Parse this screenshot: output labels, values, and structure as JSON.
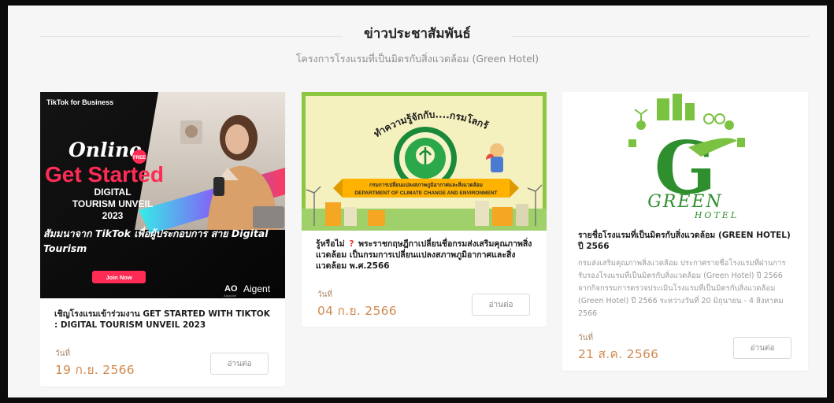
{
  "section": {
    "title": "ข่าวประชาสัมพันธ์",
    "subtitle": "โครงการโรงแรมที่เป็นมิตรกับสิ่งแวดล้อม (Green Hotel)"
  },
  "colors": {
    "accent_date": "#d08a4f",
    "tiktok_pink": "#ff2d55",
    "green_logo": "#2f8f2f"
  },
  "cards": [
    {
      "banner": {
        "brand": "TikTok for Business",
        "headline_script": "Online",
        "headline_tag": "FREE",
        "headline_big": "Get Started",
        "event_line1": "DIGITAL",
        "event_line2": "TOURISM UNVEIL",
        "event_line3": "2023",
        "thai_tagline": "สัมมนาจาก TikTok เพื่อผู้ประกอบการ สาย Digital Tourism",
        "cta": "Join Now",
        "partner_mark": "AO",
        "partner_name": "Aigent",
        "partner_sub": "AAppoint"
      },
      "title": "เชิญโรงแรมเข้าร่วมงาน GET STARTED WITH TIKTOK : DIGITAL TOURISM UNVEIL 2023",
      "date_label": "วันที่",
      "date": "19 ก.ย. 2566",
      "button": "อ่านต่อ"
    },
    {
      "banner": {
        "arc_text": "ทำความรู้จักกับ....กรมโลกร้อน ?",
        "ribbon_th": "กรมการเปลี่ยนแปลงสภาพภูมิอากาศและสิ่งแวดล้อม",
        "ribbon_en": "DEPARTMENT OF CLIMATE CHANGE AND ENVIRONMENT",
        "seal_text": "DEPARTMENT OF CLIMATE CHANGE AND ENVIRONMENT"
      },
      "title_prefix": "รู้หรือไม่",
      "title_mark": "?",
      "title": "พระราชกฤษฎีกาเปลี่ยนชื่อกรมส่งเสริมคุณภาพสิ่งแวดล้อม เป็นกรมการเปลี่ยนแปลงสภาพภูมิอากาศและสิ่งแวดล้อม พ.ศ.2566",
      "date_label": "วันที่",
      "date": "04 ก.ย. 2566",
      "button": "อ่านต่อ"
    },
    {
      "banner": {
        "logo_letter": "G",
        "logo_word": "GREEN",
        "logo_sub": "HOTEL"
      },
      "title": "รายชื่อโรงแรมที่เป็นมิตรกับสิ่งแวดล้อม (GREEN HOTEL) ปี 2566",
      "description": "กรมส่งเสริมคุณภาพสิ่งแวดล้อม ประกาศรายชื่อโรงแรมที่ผ่านการรับรองโรงแรมที่เป็นมิตรกับสิ่งแวดล้อม (Green Hotel) ปี 2566 จากกิจกรรมการตรวจประเมินโรงแรมที่เป็นมิตรกับสิ่งแวดล้อม (Green Hotel) ปี 2566 ระหว่างวันที่ 20 มิถุนายน - 4 สิงหาคม 2566",
      "date_label": "วันที่",
      "date": "21 ส.ค. 2566",
      "button": "อ่านต่อ"
    }
  ]
}
